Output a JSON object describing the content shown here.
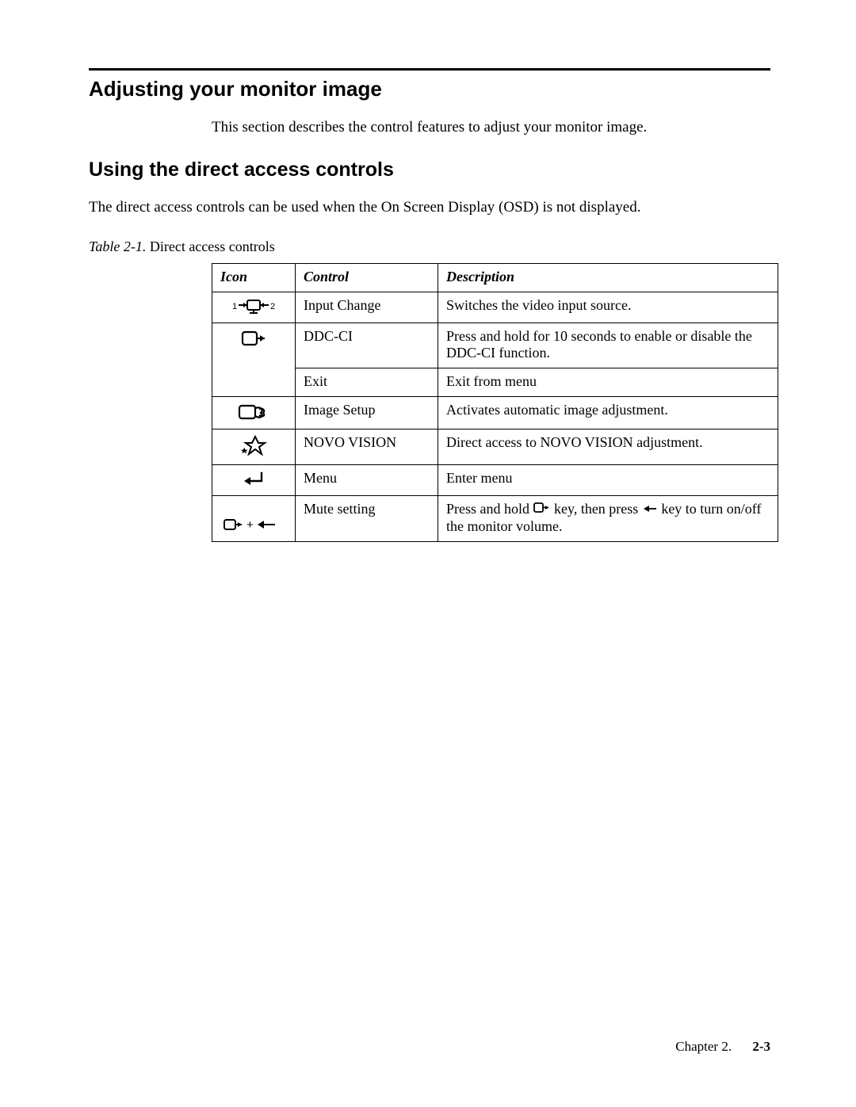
{
  "headings": {
    "h1": "Adjusting your monitor image",
    "intro": "This section describes the control features to adjust your monitor image.",
    "h2": "Using the direct access controls",
    "subintro": "The direct access controls can be used when the On Screen Display (OSD) is not displayed."
  },
  "table": {
    "caption_label": "Table 2-1.",
    "caption_text": "Direct access controls",
    "headers": {
      "icon": "Icon",
      "control": "Control",
      "description": "Description"
    },
    "rows": [
      {
        "icon": "input-change-icon",
        "control": "Input Change",
        "description": "Switches the video input source."
      },
      {
        "icon": "exit-icon",
        "control": "DDC-CI",
        "description": "Press and hold for 10 seconds to enable or disable the DDC-CI function."
      },
      {
        "icon": "",
        "control": "Exit",
        "description": "Exit from menu"
      },
      {
        "icon": "image-setup-icon",
        "control": "Image Setup",
        "description": "Activates automatic image adjustment."
      },
      {
        "icon": "novo-vision-icon",
        "control": "NOVO VISION",
        "description": "Direct access to NOVO VISION adjustment."
      },
      {
        "icon": "enter-icon",
        "control": "Menu",
        "description": "Enter menu"
      },
      {
        "icon": "mute-combo-icon",
        "control": "Mute setting",
        "description_pre": "Press and hold ",
        "description_mid": " key, then press ",
        "description_post": " key to turn on/off the monitor volume."
      }
    ]
  },
  "footer": {
    "chapter": "Chapter 2.",
    "page": "2-3"
  }
}
